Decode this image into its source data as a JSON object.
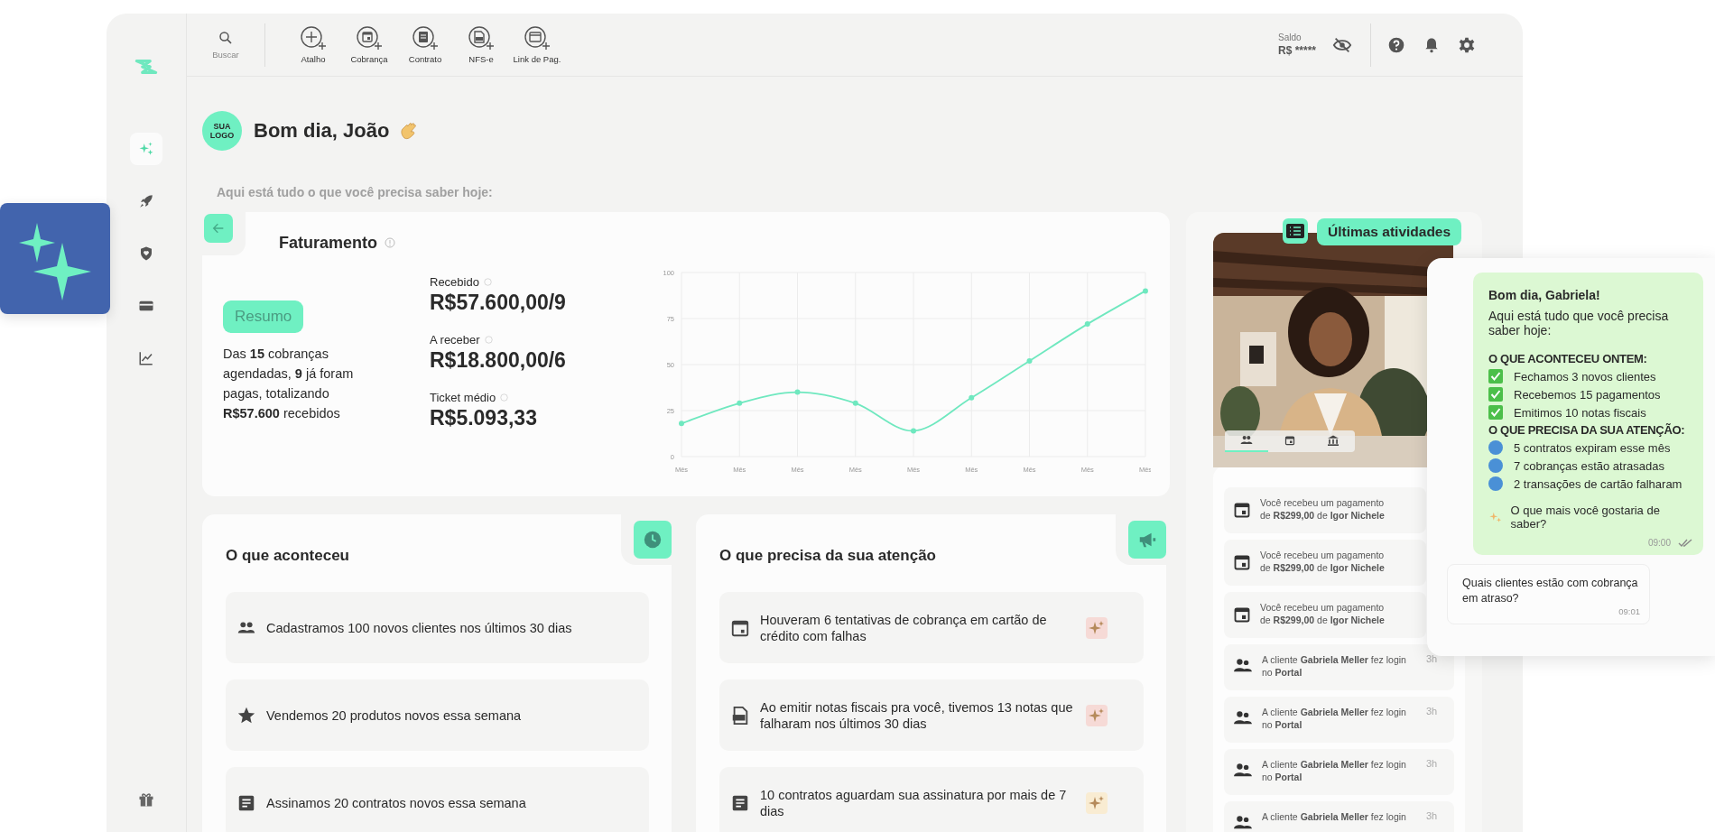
{
  "sidebar": {
    "items": [
      {
        "selected": true
      },
      {
        "selected": false
      },
      {
        "selected": false
      },
      {
        "selected": false
      },
      {
        "selected": false
      }
    ]
  },
  "toolbar": {
    "search_label": "Buscar",
    "actions": [
      {
        "label": "Atalho"
      },
      {
        "label": "Cobrança"
      },
      {
        "label": "Contrato"
      },
      {
        "label": "NFS-e"
      },
      {
        "label": "Link de Pag."
      }
    ]
  },
  "balance": {
    "label": "Saldo",
    "value": "R$ *****"
  },
  "greeting": {
    "logo_text": "SUA LOGO",
    "title": "Bom dia, João",
    "subtitle": "Aqui está tudo o que você precisa saber hoje:"
  },
  "billing": {
    "title": "Faturamento",
    "summary_button": "Resumo",
    "summary": "Das **15** cobranças agendadas, **9** já foram pagas, totalizando **R$57.600** recebidos",
    "stats": [
      {
        "label": "Recebido",
        "value": "R$57.600,00/9"
      },
      {
        "label": "A receber",
        "value": "R$18.800,00/6"
      },
      {
        "label": "Ticket médio",
        "value": "R$5.093,33"
      }
    ],
    "chart_data": {
      "type": "line",
      "categories": [
        "Mês",
        "Mês",
        "Mês",
        "Mês",
        "Mês",
        "Mês",
        "Mês",
        "Mês",
        "Mês"
      ],
      "series": [
        {
          "color": "#6fe8bf",
          "marker": true,
          "values": [
            18,
            29,
            35,
            29,
            14,
            32,
            52,
            72,
            90
          ]
        }
      ],
      "grid": true,
      "ylim": [
        0,
        100
      ],
      "yticks": [
        0,
        25,
        50,
        75,
        100
      ]
    }
  },
  "happened": {
    "title": "O que aconteceu",
    "items": [
      {
        "text": "Cadastramos 100 novos clientes nos últimos 30 dias"
      },
      {
        "text": "Vendemos 20 produtos novos essa semana"
      },
      {
        "text": "Assinamos 20 contratos novos essa semana"
      }
    ]
  },
  "attention": {
    "title": "O que precisa da sua atenção",
    "items": [
      {
        "text": "Houveram 6 tentativas de cobrança em cartão de crédito com falhas",
        "color": "#f6dad6"
      },
      {
        "text": "Ao emitir notas fiscais pra você, tivemos 13 notas que falharam nos últimos 30 dias",
        "color": "#f6dad6"
      },
      {
        "text": "10 contratos aguardam sua assinatura por mais de 7 dias",
        "color": "#f9ecd2"
      }
    ]
  },
  "activities": {
    "title": "Últimas atividades",
    "tabs": [
      {
        "selected": true
      },
      {
        "selected": false
      },
      {
        "selected": false
      }
    ],
    "items": [
      {
        "kind": "payment",
        "text": "Você recebeu um pagamento de **R$299,00** de **Igor Nichele**"
      },
      {
        "kind": "payment",
        "text": "Você recebeu um pagamento de **R$299,00** de **Igor Nichele**"
      },
      {
        "kind": "payment",
        "text": "Você recebeu um pagamento de **R$299,00** de **Igor Nichele**"
      },
      {
        "kind": "login",
        "text": "A cliente **Gabriela Meller** fez login no **Portal**",
        "time": "3h"
      },
      {
        "kind": "login",
        "text": "A cliente **Gabriela Meller** fez login no **Portal**",
        "time": "3h"
      },
      {
        "kind": "login",
        "text": "A cliente **Gabriela Meller** fez login no **Portal**",
        "time": "3h"
      },
      {
        "kind": "login",
        "text": "A cliente **Gabriela Meller** fez login",
        "time": "3h"
      }
    ]
  },
  "chat": {
    "bot": {
      "title": "Bom dia, Gabriela!",
      "intro": "Aqui está tudo que você precisa saber hoje:",
      "sections": [
        {
          "kind": "done",
          "heading": "O QUE ACONTECEU ONTEM:",
          "items": [
            "Fechamos 3 novos clientes",
            "Recebemos 15 pagamentos",
            "Emitimos 10 notas fiscais"
          ]
        },
        {
          "kind": "alert",
          "heading": "O QUE PRECISA DA SUA ATENÇÃO:",
          "items": [
            "5 contratos expiram esse mês",
            "7 cobranças estão atrasadas",
            "2 transações de cartão falharam"
          ]
        }
      ],
      "question": "O que mais você gostaria de saber?",
      "time": "09:00"
    },
    "user": {
      "text": "Quais clientes estão com cobrança em atraso?",
      "time": "09:01"
    }
  }
}
